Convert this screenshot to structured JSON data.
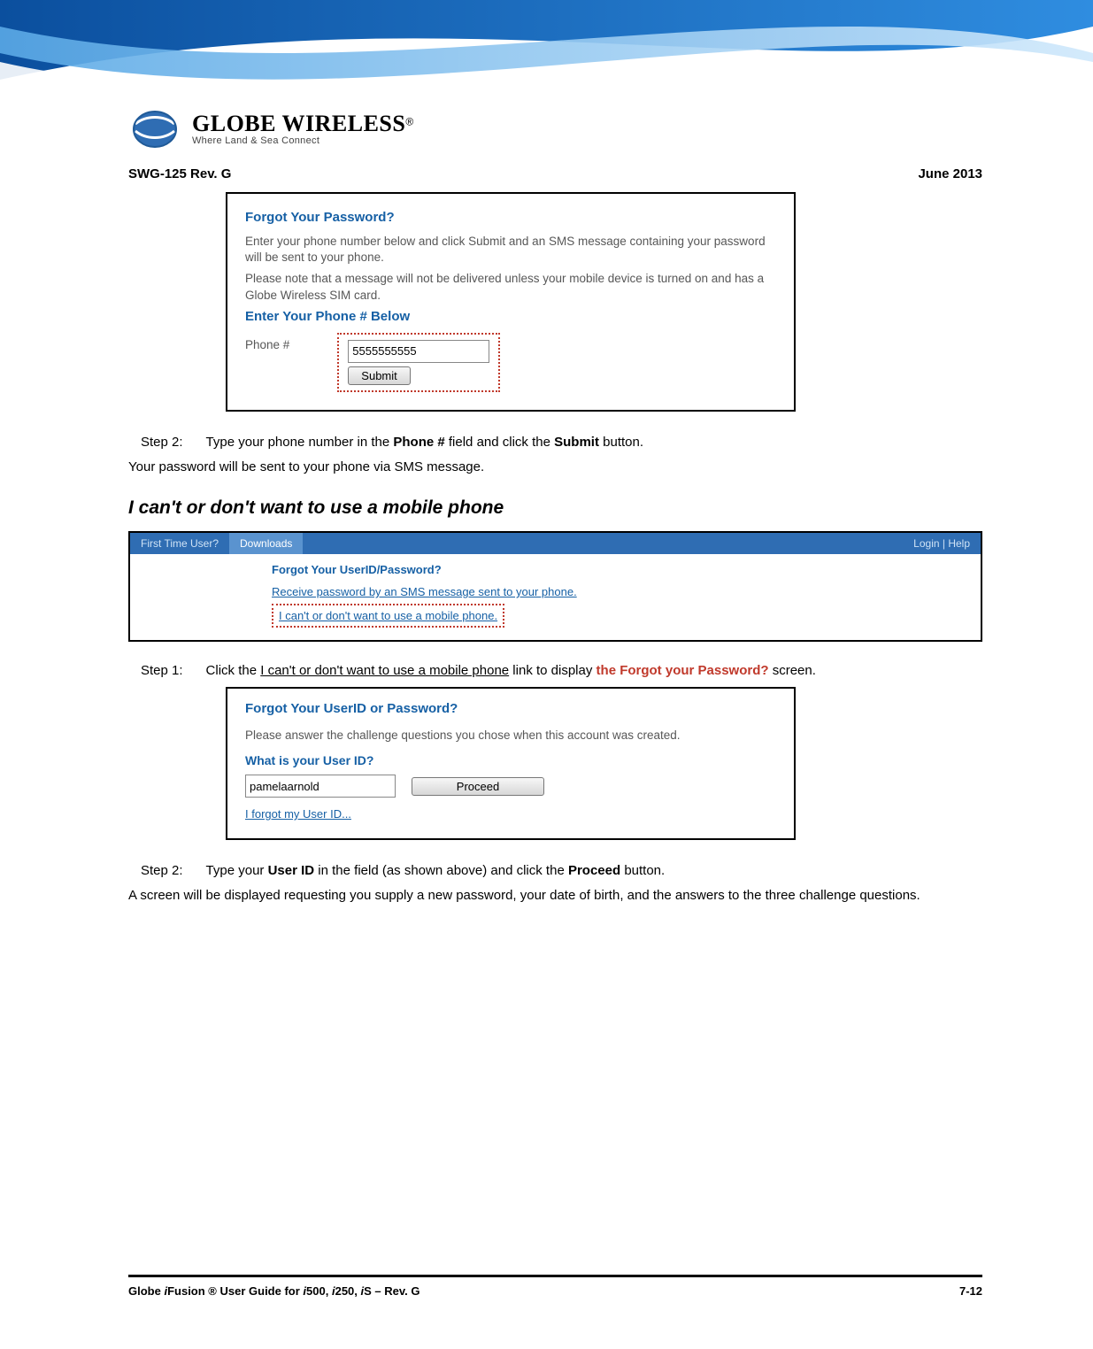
{
  "header": {
    "doc_id": "SWG-125 Rev. G",
    "date": "June 2013",
    "brand": "GLOBE WIRELESS",
    "tagline": "Where Land & Sea Connect"
  },
  "shot_forgot_pw": {
    "title": "Forgot Your Password?",
    "p1": "Enter your phone number below and click Submit and an SMS message containing your password will be sent to your phone.",
    "p2": "Please note that a message will not be delivered unless your mobile device is turned on and has a Globe Wireless SIM card.",
    "enter_label": "Enter Your Phone # Below",
    "phone_label": "Phone #",
    "phone_value": "5555555555",
    "submit": "Submit"
  },
  "step2a": {
    "label": "Step  2:",
    "text_before": "Type your phone number in the ",
    "bold1": "Phone #",
    "mid": " field and click the ",
    "bold2": "Submit",
    "after": " button."
  },
  "para_sent": "Your password will be sent to your phone via SMS message.",
  "section_heading": "I can't or don't want to use a mobile phone",
  "strip": {
    "tab1": "First Time User?",
    "tab2": "Downloads",
    "right": "Login  | Help",
    "hd": "Forgot Your UserID/Password?",
    "link1": "Receive password by an SMS message sent to your phone.",
    "link2": "I can't or don't want to use a mobile phone."
  },
  "step1": {
    "label": "Step  1:",
    "before": "Click the ",
    "ulink": "I can't or don't want to use a mobile phone",
    "mid": " link to display ",
    "red": "the Forgot your Password?",
    "after": " screen."
  },
  "shot_userid": {
    "title": "Forgot Your UserID or Password?",
    "p": "Please answer the challenge questions you chose when this account was created.",
    "q": "What is your User ID?",
    "value": "pamelaarnold",
    "proceed": "Proceed",
    "forgot": "I forgot my User ID..."
  },
  "step2b": {
    "label": "Step  2:",
    "before": "Type your ",
    "bold1": "User ID",
    "mid": " in the field (as shown above) and click the ",
    "bold2": "Proceed",
    "after": " button."
  },
  "para_final": "A screen will be displayed requesting you supply a new password, your date of birth, and the answers to the three challenge questions.",
  "footer": {
    "left_a": "Globe ",
    "left_i1": "i",
    "left_b": "Fusion",
    "left_reg": " ® ",
    "left_c": "User Guide for ",
    "left_i2": "i",
    "left_d": "500, ",
    "left_i3": "i",
    "left_e": "250, ",
    "left_i4": "i",
    "left_f": "S – Rev. G",
    "page": "7-12"
  }
}
